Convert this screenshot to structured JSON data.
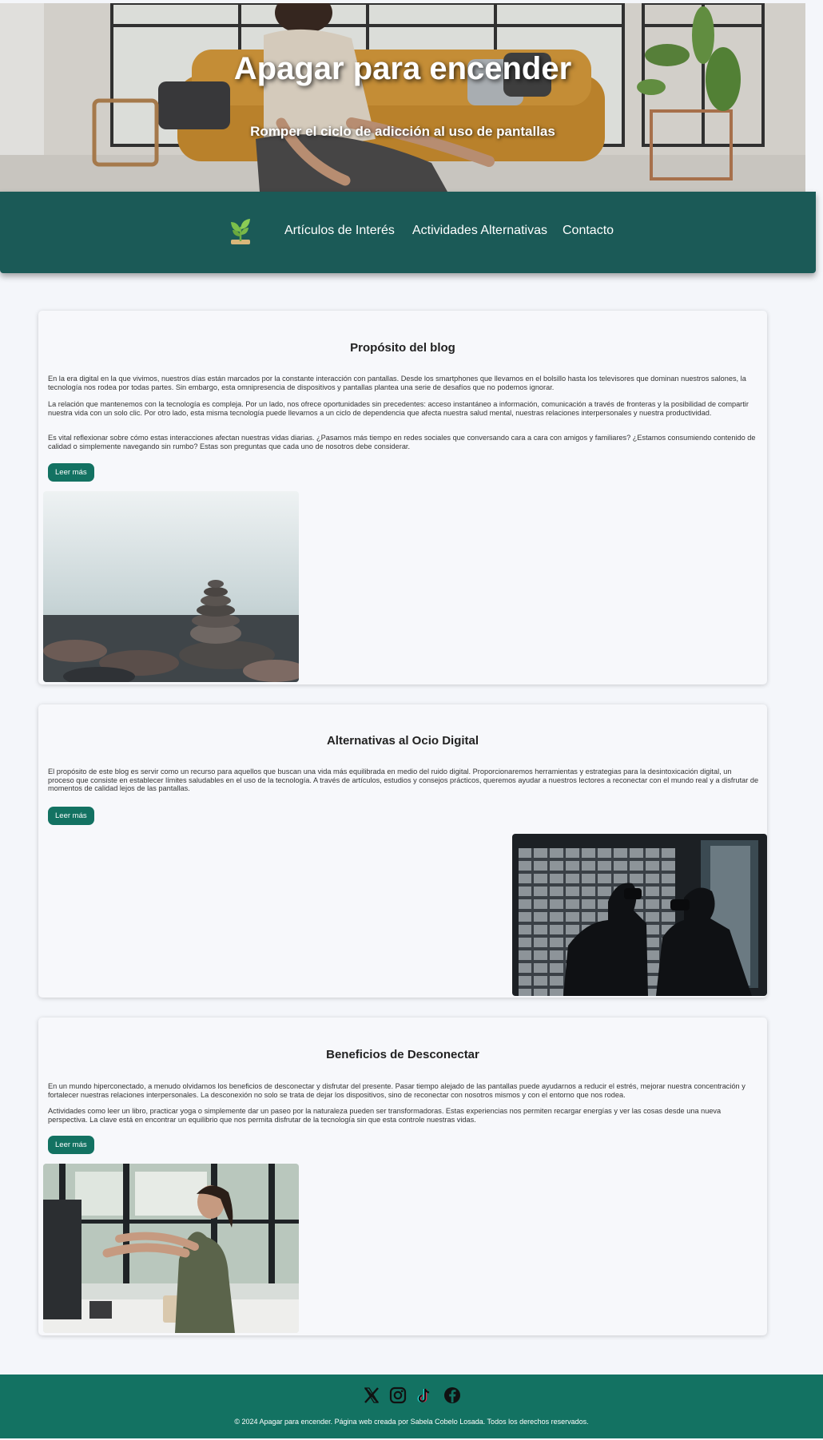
{
  "hero": {
    "title": "Apagar para encender",
    "subtitle": "Romper el ciclo de adicción al uso de pantallas",
    "image_icon": "meditation-photo"
  },
  "nav": {
    "logo_icon": "sprout-icon",
    "links": [
      "Artículos de Interés",
      "Actividades Alternativas",
      "Contacto"
    ]
  },
  "posts": [
    {
      "title": "Propósito del blog",
      "paragraphs": [
        "En la era digital en la que vivimos, nuestros días están marcados por la constante interacción con pantallas. Desde los smartphones que llevamos en el bolsillo hasta los televisores que dominan nuestros salones, la tecnología nos rodea por todas partes. Sin embargo, esta omnipresencia de dispositivos y pantallas plantea una serie de desafíos que no podemos ignorar.",
        "La relación que mantenemos con la tecnología es compleja. Por un lado, nos ofrece oportunidades sin precedentes: acceso instantáneo a información, comunicación a través de fronteras y la posibilidad de compartir nuestra vida con un solo clic. Por otro lado, esta misma tecnología puede llevarnos a un ciclo de dependencia que afecta nuestra salud mental, nuestras relaciones interpersonales y nuestra productividad.",
        "Es vital reflexionar sobre cómo estas interacciones afectan nuestras vidas diarias. ¿Pasamos más tiempo en redes sociales que conversando cara a cara con amigos y familiares? ¿Estamos consumiendo contenido de calidad o simplemente navegando sin rumbo? Estas son preguntas que cada uno de nosotros debe considerar."
      ],
      "button": "Leer más",
      "image_icon": "stacked-stones-photo"
    },
    {
      "title": "Alternativas al Ocio Digital",
      "paragraphs": [
        "El propósito de este blog es servir como un recurso para aquellos que buscan una vida más equilibrada en medio del ruido digital. Proporcionaremos herramientas y estrategias para la desintoxicación digital, un proceso que consiste en establecer límites saludables en el uso de la tecnología. A través de artículos, estudios y consejos prácticos, queremos ayudar a nuestros lectores a reconectar con el mundo real y a disfrutar de momentos de calidad lejos de las pantallas."
      ],
      "button": "Leer más",
      "image_icon": "vr-silhouettes-photo"
    },
    {
      "title": "Beneficios de Desconectar",
      "paragraphs": [
        "En un mundo hiperconectado, a menudo olvidamos los beneficios de desconectar y disfrutar del presente. Pasar tiempo alejado de las pantallas puede ayudarnos a reducir el estrés, mejorar nuestra concentración y fortalecer nuestras relaciones interpersonales. La desconexión no solo se trata de dejar los dispositivos, sino de reconectar con nosotros mismos y con el entorno que nos rodea.",
        "Actividades como leer un libro, practicar yoga o simplemente dar un paseo por la naturaleza pueden ser transformadoras. Estas experiencias nos permiten recargar energías y ver las cosas desde una nueva perspectiva. La clave está en encontrar un equilibrio que nos permita disfrutar de la tecnología sin que esta controle nuestras vidas."
      ],
      "button": "Leer más",
      "image_icon": "office-stretch-photo"
    }
  ],
  "footer": {
    "social_icons": [
      "x-icon",
      "instagram-icon",
      "tiktok-icon",
      "facebook-icon"
    ],
    "text": "© 2024 Apagar para encender. Página web creada por Sabela Cobelo Losada. Todos los derechos reservados."
  },
  "colors": {
    "nav_bg": "#1b5a57",
    "accent": "#137262",
    "page_bg": "#f4f6fa"
  }
}
